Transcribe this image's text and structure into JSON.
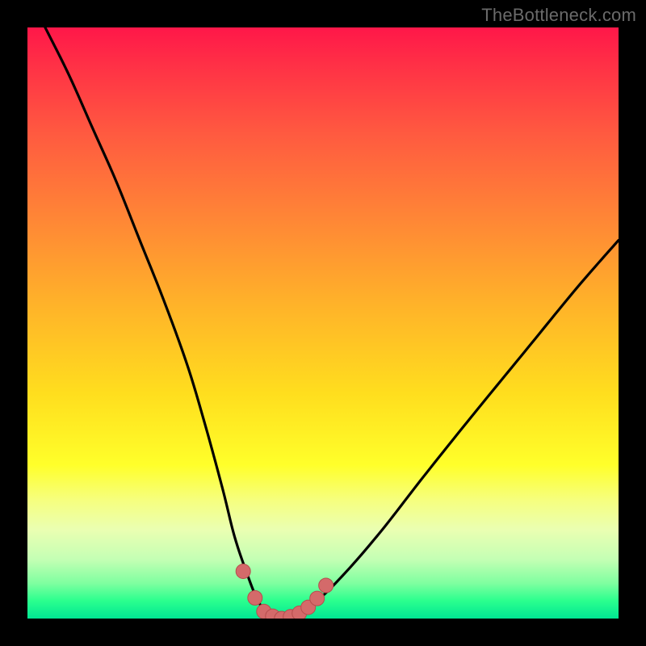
{
  "watermark": "TheBottleneck.com",
  "colors": {
    "background_outer": "#000000",
    "gradient_top": "#ff1749",
    "gradient_bottom": "#00e693",
    "curve_stroke": "#000000",
    "marker_fill": "#d46a6a",
    "marker_stroke": "#b64d4d"
  },
  "chart_data": {
    "type": "line",
    "title": "",
    "xlabel": "",
    "ylabel": "",
    "xlim": [
      0,
      100
    ],
    "ylim": [
      0,
      100
    ],
    "grid": false,
    "note": "Axes are implicit (no tick labels shown). x roughly represents a component ratio; y roughly represents bottleneck percentage. Values estimated from the plotted curve.",
    "series": [
      {
        "name": "bottleneck-curve",
        "x": [
          0,
          3,
          7,
          11,
          15,
          19,
          23,
          27,
          30,
          33,
          35,
          37,
          39,
          41,
          43,
          45,
          49,
          54,
          60,
          67,
          75,
          84,
          93,
          100
        ],
        "y": [
          106,
          100,
          92,
          83,
          74,
          64,
          54,
          43,
          33,
          22,
          14,
          8,
          3,
          0.5,
          0,
          0.5,
          3,
          8,
          15,
          24,
          34,
          45,
          56,
          64
        ]
      }
    ],
    "markers": {
      "name": "highlighted-segment",
      "x": [
        36.5,
        38.5,
        40.0,
        41.5,
        43.0,
        44.5,
        46.0,
        47.5,
        49.0,
        50.5
      ],
      "y": [
        8.0,
        3.5,
        1.2,
        0.4,
        0.0,
        0.3,
        0.9,
        1.9,
        3.4,
        5.6
      ]
    }
  }
}
